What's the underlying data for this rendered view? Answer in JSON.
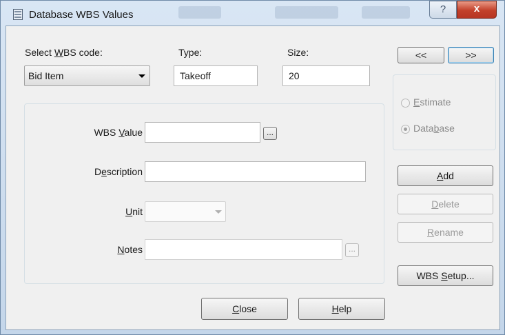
{
  "window": {
    "title": "Database WBS Values",
    "help_glyph": "?",
    "close_glyph": "x"
  },
  "nav": {
    "prev_label": "<<",
    "next_label": ">>"
  },
  "wbs_code": {
    "label_pre": "Select ",
    "label_key": "W",
    "label_post": "BS code:",
    "selected": "Bid Item"
  },
  "type": {
    "label": "Type:",
    "value": "Takeoff"
  },
  "size": {
    "label": "Size:",
    "value": "20"
  },
  "fields": {
    "wbs_value": {
      "pre": "WBS ",
      "key": "V",
      "post": "alue",
      "value": "",
      "browse": "..."
    },
    "description": {
      "pre": "D",
      "key": "e",
      "post": "scription",
      "value": ""
    },
    "unit": {
      "pre": "",
      "key": "U",
      "post": "nit",
      "value": ""
    },
    "notes": {
      "pre": "",
      "key": "N",
      "post": "otes",
      "value": "",
      "browse": "..."
    }
  },
  "source": {
    "estimate": {
      "pre": "",
      "key": "E",
      "post": "stimate",
      "selected": false
    },
    "database": {
      "pre": "Data",
      "key": "b",
      "post": "ase",
      "selected": true
    }
  },
  "actions": {
    "add": {
      "pre": "",
      "key": "A",
      "post": "dd"
    },
    "delete": {
      "pre": "",
      "key": "D",
      "post": "elete"
    },
    "rename": {
      "pre": "",
      "key": "R",
      "post": "ename"
    },
    "setup": {
      "pre": "WBS ",
      "key": "S",
      "post": "etup..."
    }
  },
  "footer": {
    "close": {
      "pre": "",
      "key": "C",
      "post": "lose"
    },
    "help": {
      "pre": "",
      "key": "H",
      "post": "elp"
    }
  }
}
